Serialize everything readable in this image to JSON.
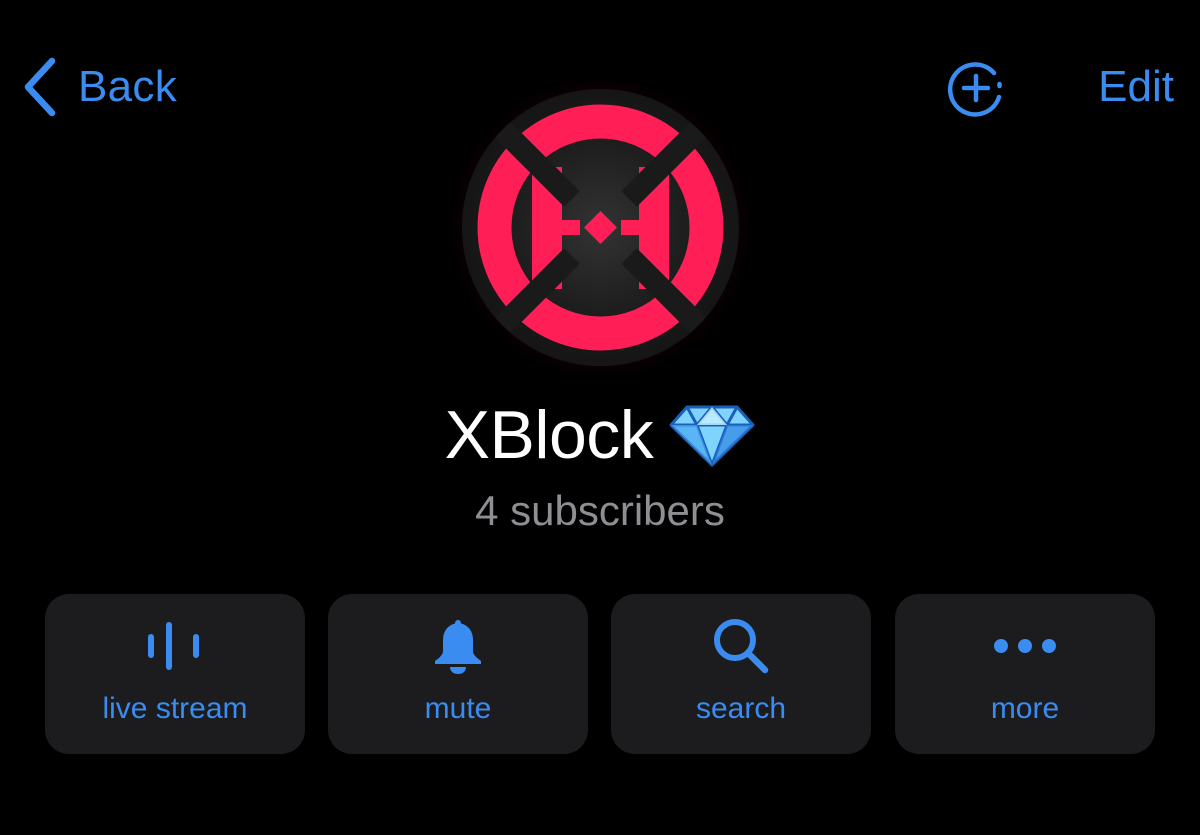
{
  "header": {
    "back_label": "Back",
    "add_icon": "circle-plus-dashed-icon",
    "edit_label": "Edit"
  },
  "profile": {
    "avatar_icon": "xblock-logo",
    "name": "XBlock",
    "badge_icon": "diamond-emoji-icon",
    "subscribers": "4 subscribers"
  },
  "actions": [
    {
      "label": "live stream",
      "icon": "waveform-bars-icon"
    },
    {
      "label": "mute",
      "icon": "bell-icon"
    },
    {
      "label": "search",
      "icon": "magnifier-icon"
    },
    {
      "label": "more",
      "icon": "ellipsis-icon"
    }
  ],
  "colors": {
    "background": "#000000",
    "accent": "#3a8cf0",
    "tile": "#1c1c1e",
    "secondary_text": "#8e8e93",
    "logo": "#ff1e56"
  }
}
